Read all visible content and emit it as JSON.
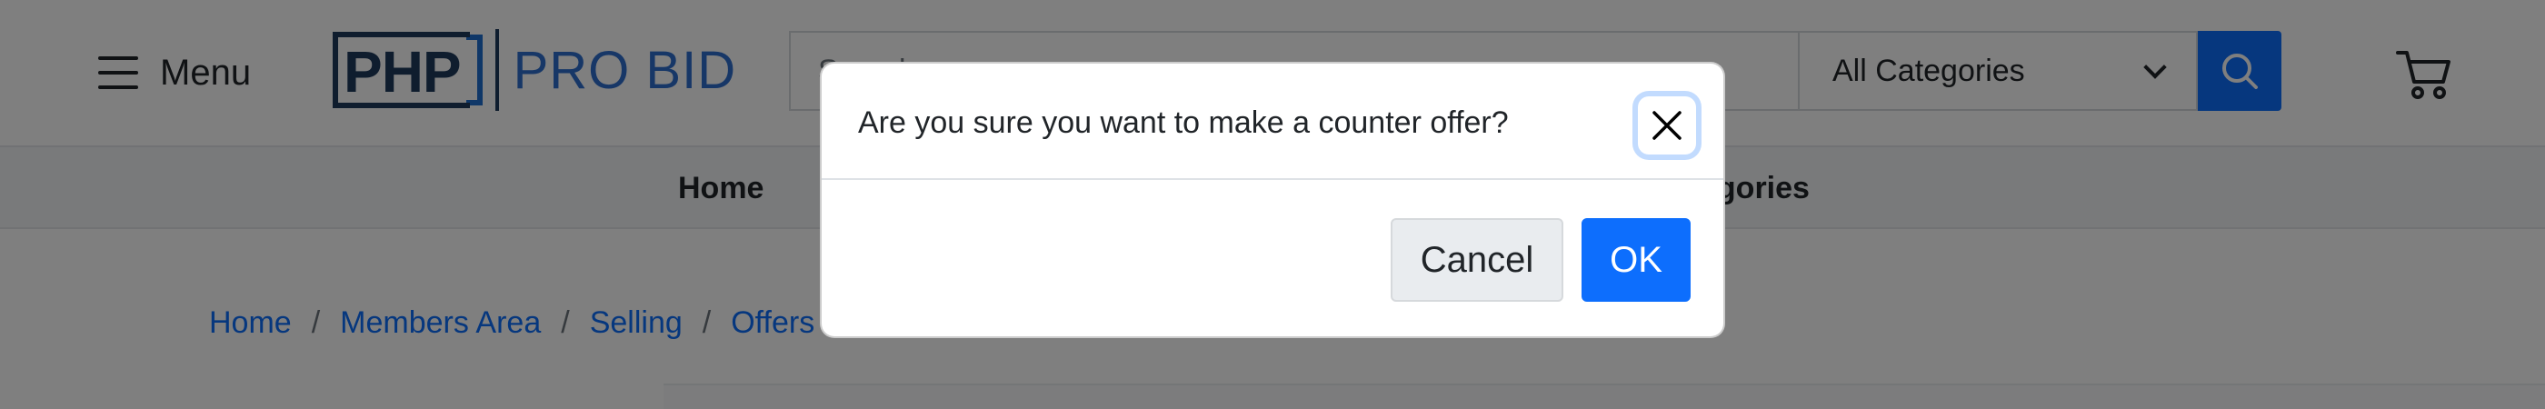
{
  "header": {
    "menu_label": "Menu",
    "logo_mark": "PHP",
    "logo_text": "PRO BID",
    "search_placeholder": "Search",
    "category_selected": "All Categories"
  },
  "nav": {
    "items": [
      "Home",
      "egories"
    ]
  },
  "breadcrumb": {
    "items": [
      "Home",
      "Members Area",
      "Selling",
      "Offers"
    ],
    "separator": "/"
  },
  "dialog": {
    "message": "Are you sure you want to make a counter offer?",
    "cancel_label": "Cancel",
    "ok_label": "OK"
  },
  "colors": {
    "primary": "#0d6efd",
    "logo_dark": "#1f3a5c",
    "logo_blue": "#2f6fcf"
  }
}
